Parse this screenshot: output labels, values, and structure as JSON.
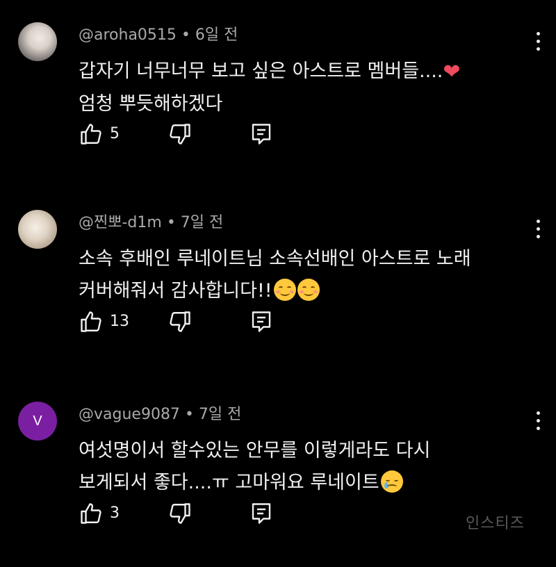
{
  "colors": {
    "background": "#000000",
    "text_primary": "#f1f1f1",
    "text_secondary": "#aaaaaa",
    "avatar_letter_bg": "#7b1fa2",
    "heart": "#ef4a5f"
  },
  "comments": [
    {
      "author": "@aroha0515",
      "time": "6일 전",
      "avatar": "photo",
      "lines": [
        "갑자기 너무너무 보고 싶은 아스트로 멤버들....",
        "엄청 뿌듯해하겠다"
      ],
      "emoji": "heart",
      "likes": "5"
    },
    {
      "author": "@찐뽀-d1m",
      "time": "7일 전",
      "avatar": "photo",
      "lines": [
        "소속 후배인 루네이트님 소속선배인 아스트로 노래",
        "커버해줘서 감사합니다!!"
      ],
      "emoji": "smiling-face-with-smiling-eyes x2",
      "likes": "13"
    },
    {
      "author": "@vague9087",
      "time": "7일 전",
      "avatar_letter": "V",
      "lines": [
        "여섯명이서 할수있는 안무를 이렇게라도 다시",
        "보게되서 좋다....ㅠ 고마워요 루네이트"
      ],
      "emoji": "crying-face",
      "likes": "3"
    }
  ],
  "separator": "•",
  "icons": {
    "like": "thumbs-up-icon",
    "dislike": "thumbs-down-icon",
    "reply": "reply-icon",
    "more": "more-vert-icon"
  },
  "watermark": "인스티즈"
}
